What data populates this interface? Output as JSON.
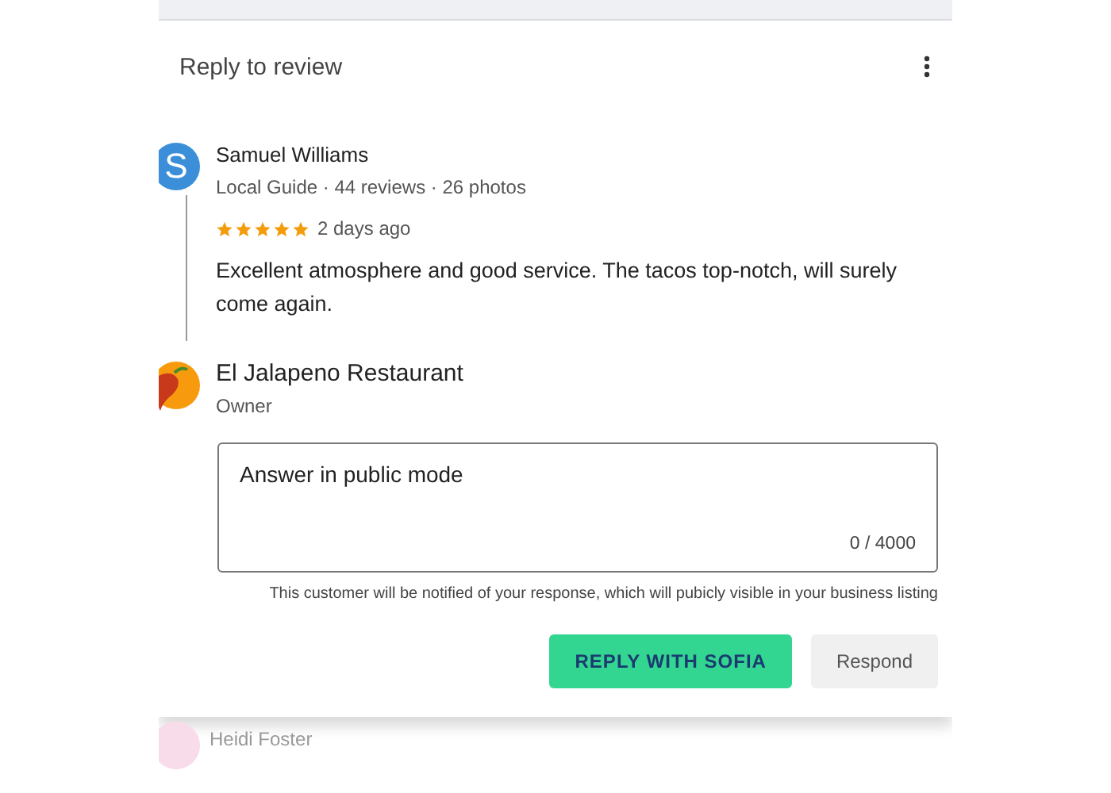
{
  "dialog": {
    "title": "Reply to review"
  },
  "review": {
    "avatar_letter": "S",
    "author": "Samuel Williams",
    "meta": "Local Guide · 44 reviews · 26 photos",
    "stars": 5,
    "time": "2 days ago",
    "text": "Excellent atmosphere and good service. The tacos top-notch, will surely come again."
  },
  "owner": {
    "name": "El Jalapeno Restaurant",
    "role": "Owner"
  },
  "reply": {
    "placeholder": "Answer in public mode",
    "counter": "0 / 4000",
    "notice": "This customer will be notified of your response, which will pubicly visible in your business listing"
  },
  "buttons": [
    {
      "kind": "primary",
      "label": "REPLY WITH SOFIA"
    },
    {
      "kind": "secondary",
      "label": "Respond"
    }
  ],
  "next_review": {
    "author": "Heidi Foster"
  }
}
